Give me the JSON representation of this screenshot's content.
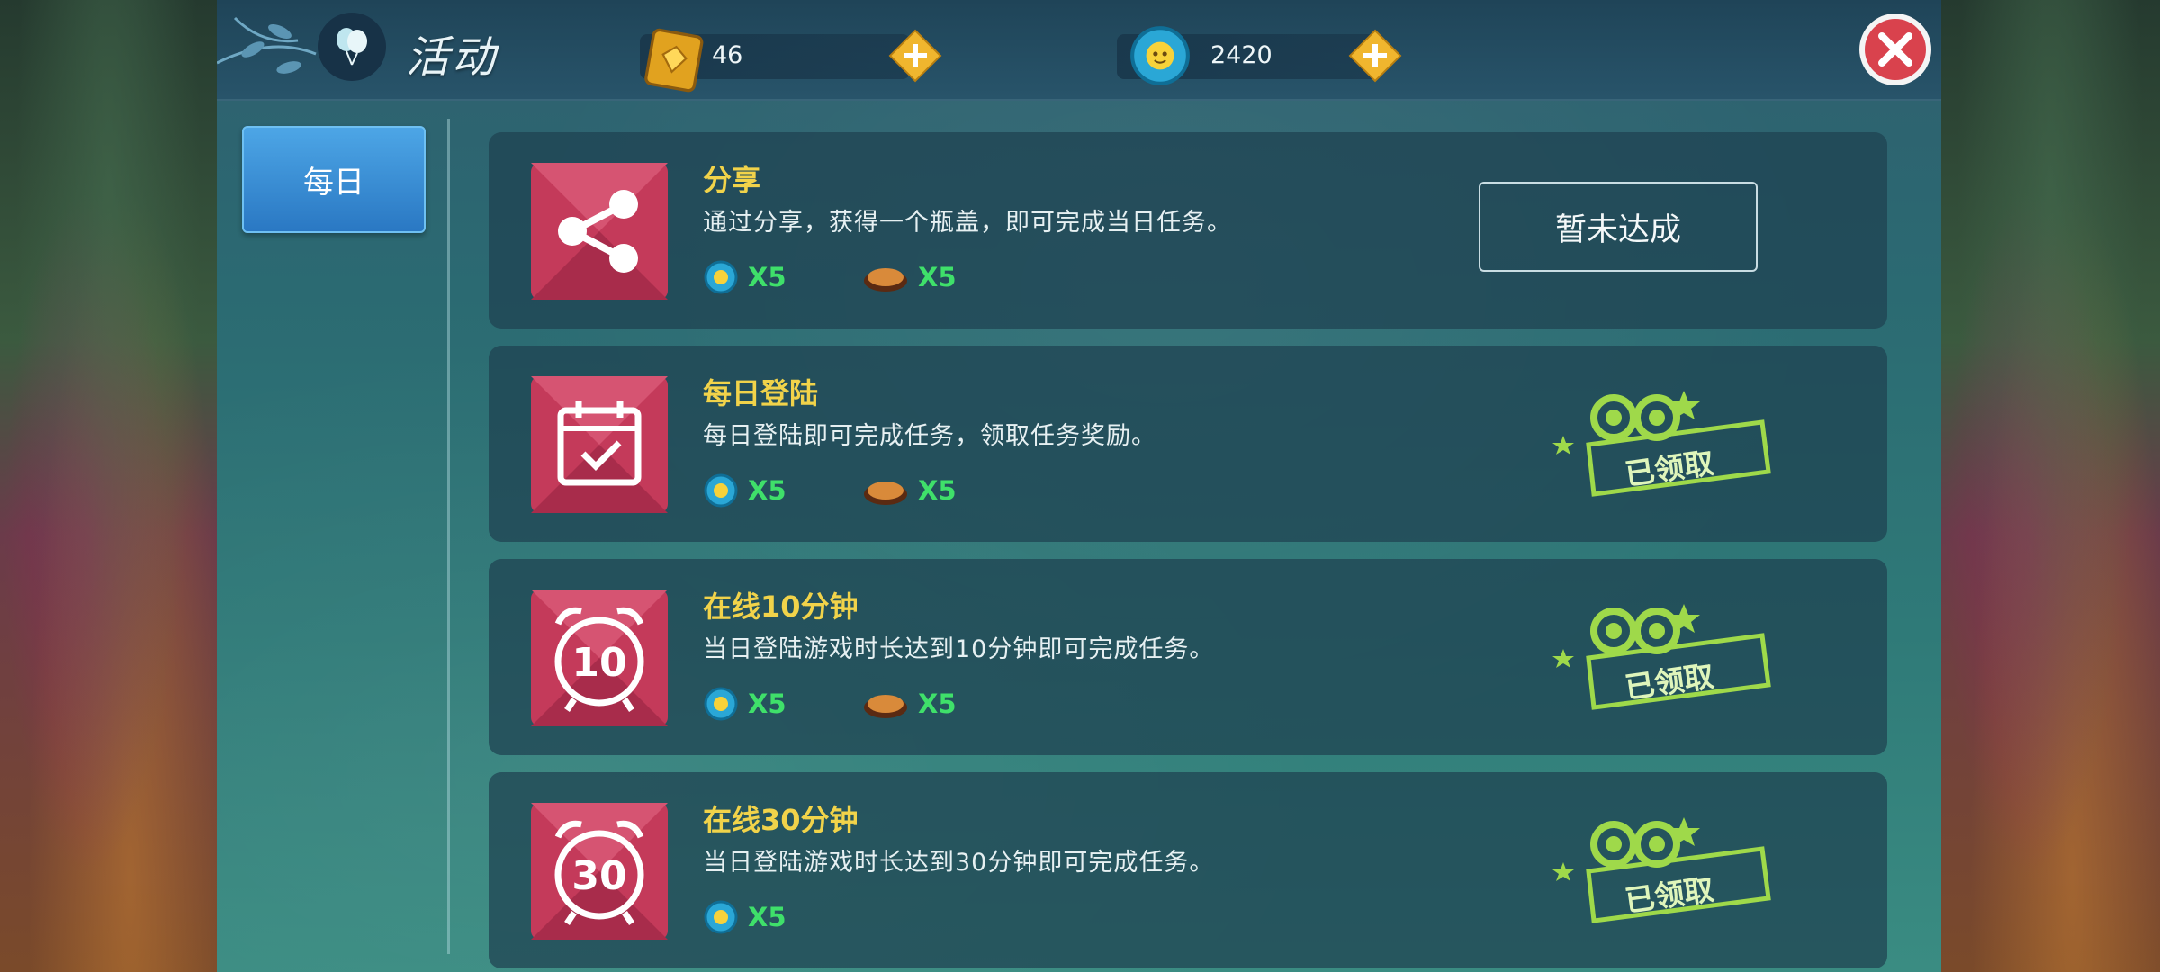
{
  "header": {
    "title": "活动",
    "gems_value": "46",
    "coins_value": "2420"
  },
  "tabs": [
    {
      "label": "每日"
    }
  ],
  "tasks": [
    {
      "title": "分享",
      "description": "通过分享，获得一个瓶盖，即可完成当日任务。",
      "icon": "share-icon",
      "rewards": [
        "X5",
        "X5"
      ],
      "status": "暂未达成"
    },
    {
      "title": "每日登陆",
      "description": "每日登陆即可完成任务，领取任务奖励。",
      "icon": "calendar-check-icon",
      "rewards": [
        "X5",
        "X5"
      ],
      "status": "已领取"
    },
    {
      "title": "在线10分钟",
      "description": "当日登陆游戏时长达到10分钟即可完成任务。",
      "icon": "alarm-clock-icon",
      "icon_number": "10",
      "rewards": [
        "X5",
        "X5"
      ],
      "status": "已领取"
    },
    {
      "title": "在线30分钟",
      "description": "当日登陆游戏时长达到30分钟即可完成任务。",
      "icon": "alarm-clock-icon",
      "icon_number": "30",
      "rewards": [
        "X5"
      ],
      "status": "已领取"
    }
  ],
  "colors": {
    "title_yellow": "#f1d34a",
    "reward_green": "#3fe06a",
    "tab_blue": "#2a78c3",
    "icon_red": "#c43a5a",
    "stamp_green": "#9fd94a"
  }
}
